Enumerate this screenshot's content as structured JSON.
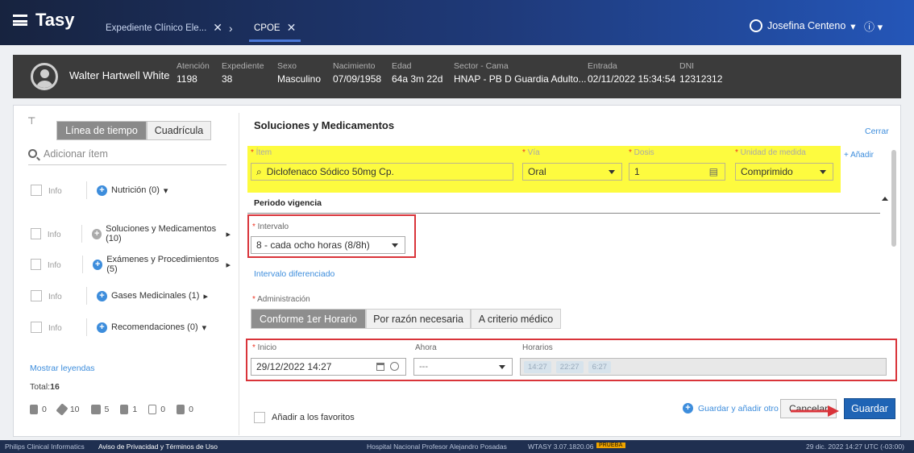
{
  "header": {
    "app_name": "Tasy",
    "tabs": [
      {
        "label": "Expediente Clínico Ele..."
      },
      {
        "label": "CPOE"
      }
    ],
    "user_name": "Josefina Centeno",
    "info_label": "ⓘ"
  },
  "patient": {
    "name": "Walter Hartwell White",
    "fields": [
      {
        "label": "Atención",
        "value": "1198"
      },
      {
        "label": "Expediente",
        "value": "38"
      },
      {
        "label": "Sexo",
        "value": "Masculino"
      },
      {
        "label": "Nacimiento",
        "value": "07/09/1958"
      },
      {
        "label": "Edad",
        "value": "64a 3m 22d"
      },
      {
        "label": "Sector - Cama",
        "value": "HNAP - PB D Guardia Adulto..."
      },
      {
        "label": "Entrada",
        "value": "02/11/2022 15:34:54"
      },
      {
        "label": "DNI",
        "value": "12312312"
      }
    ]
  },
  "sidebar": {
    "view_tabs": [
      "Línea de tiempo",
      "Cuadrícula"
    ],
    "search_placeholder": "Adicionar ítem",
    "info_label": "Info",
    "categories": [
      {
        "label": "Nutrición (0)",
        "arrow": "▾"
      },
      {
        "label": "Soluciones y Medicamentos (10)",
        "arrow": "▸"
      },
      {
        "label": "Exámenes y Procedimientos (5)",
        "arrow": "▸"
      },
      {
        "label": "Gases Medicinales (1)",
        "arrow": "▸"
      },
      {
        "label": "Recomendaciones (0)",
        "arrow": "▾"
      }
    ],
    "show_legends": "Mostrar leyendas",
    "total_label": "Total:",
    "total_value": "16",
    "counters": [
      {
        "icon": "fork-knife-icon",
        "value": "0"
      },
      {
        "icon": "syringe-icon",
        "value": "10"
      },
      {
        "icon": "lab-icon",
        "value": "5"
      },
      {
        "icon": "gas-icon",
        "value": "1"
      },
      {
        "icon": "note-icon",
        "value": "0"
      },
      {
        "icon": "bag-icon",
        "value": "0"
      }
    ]
  },
  "form": {
    "title": "Soluciones y Medicamentos",
    "close_label": "Cerrar",
    "add_label": "+ Añadir",
    "item_label": "Ítem",
    "item_value": "Diclofenaco Sódico 50mg Cp.",
    "via_label": "Vía",
    "via_value": "Oral",
    "dosis_label": "Dosis",
    "dosis_value": "1",
    "unidad_label": "Unidad de medida",
    "unidad_value": "Comprimido",
    "periodo_label": "Periodo vigencia",
    "intervalo_label": "Intervalo",
    "intervalo_value": "8 - cada ocho horas (8/8h)",
    "intervalo_diferenciado": "Intervalo diferenciado",
    "administracion_label": "Administración",
    "admin_options": [
      "Conforme 1er Horario",
      "Por razón necesaria",
      "A criterio médico"
    ],
    "inicio_label": "Inicio",
    "inicio_value": "29/12/2022 14:27",
    "ahora_label": "Ahora",
    "ahora_value": "---",
    "horarios_label": "Horarios",
    "horarios": [
      "14:27",
      "22:27",
      "6:27"
    ],
    "favoritos_label": "Añadir a los favoritos",
    "guardar_otro": "Guardar y añadir otro",
    "cancelar": "Cancelar",
    "guardar": "Guardar"
  },
  "footer": {
    "company": "Philips Clinical Informatics",
    "privacy": "Aviso de Privacidad y Términos de Uso",
    "hospital": "Hospital Nacional Profesor Alejandro Posadas",
    "version": "WTASY 3.07.1820.06",
    "env": "PRUEBA",
    "datetime": "29 dic. 2022  14:27  UTC (-03:00)"
  },
  "colors": {
    "accent": "#3d8ddc",
    "highlight": "#fdfb3f",
    "alert_box": "#d9343a",
    "primary_button": "#1f64b5"
  }
}
